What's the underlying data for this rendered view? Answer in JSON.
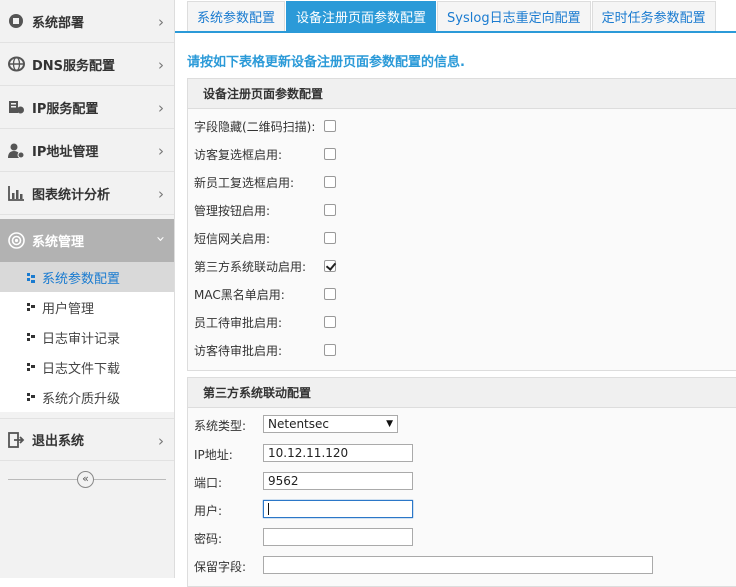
{
  "sidebar": {
    "items": [
      {
        "label": "系统部署",
        "icon": "deploy-icon"
      },
      {
        "label": "DNS服务配置",
        "icon": "globe-icon"
      },
      {
        "label": "IP服务配置",
        "icon": "server-icon"
      },
      {
        "label": "IP地址管理",
        "icon": "user-gear-icon"
      },
      {
        "label": "图表统计分析",
        "icon": "bar-chart-icon"
      },
      {
        "label": "系统管理",
        "icon": "settings-icon"
      }
    ],
    "sub_items": [
      {
        "label": "系统参数配置"
      },
      {
        "label": "用户管理"
      },
      {
        "label": "日志审计记录"
      },
      {
        "label": "日志文件下载"
      },
      {
        "label": "系统介质升级"
      }
    ],
    "logout": {
      "label": "退出系统",
      "icon": "logout-icon"
    },
    "collapse_glyph": "«"
  },
  "tabs": [
    "系统参数配置",
    "设备注册页面参数配置",
    "Syslog日志重定向配置",
    "定时任务参数配置"
  ],
  "intro": "请按如下表格更新设备注册页面参数配置的信息.",
  "panel1": {
    "title": "设备注册页面参数配置",
    "rows": [
      {
        "label": "字段隐藏(二维码扫描):",
        "checked": false
      },
      {
        "label": "访客复选框启用:",
        "checked": false
      },
      {
        "label": "新员工复选框启用:",
        "checked": false
      },
      {
        "label": "管理按钮启用:",
        "checked": false
      },
      {
        "label": "短信网关启用:",
        "checked": false
      },
      {
        "label": "第三方系统联动启用:",
        "checked": true
      },
      {
        "label": "MAC黑名单启用:",
        "checked": false
      },
      {
        "label": "员工待审批启用:",
        "checked": false
      },
      {
        "label": "访客待审批启用:",
        "checked": false
      }
    ]
  },
  "panel2": {
    "title": "第三方系统联动配置",
    "system_type": {
      "label": "系统类型:",
      "value": "Netentsec"
    },
    "ip": {
      "label": "IP地址:",
      "value": "10.12.11.120"
    },
    "port": {
      "label": "端口:",
      "value": "9562"
    },
    "user": {
      "label": "用户:",
      "value": ""
    },
    "password": {
      "label": "密码:",
      "value": ""
    },
    "reserved": {
      "label": "保留字段:",
      "value": ""
    }
  },
  "colors": {
    "accent": "#2b9ad8",
    "active_menu": "#b2b2b2",
    "sidebar_bg": "#f2f2f2"
  }
}
